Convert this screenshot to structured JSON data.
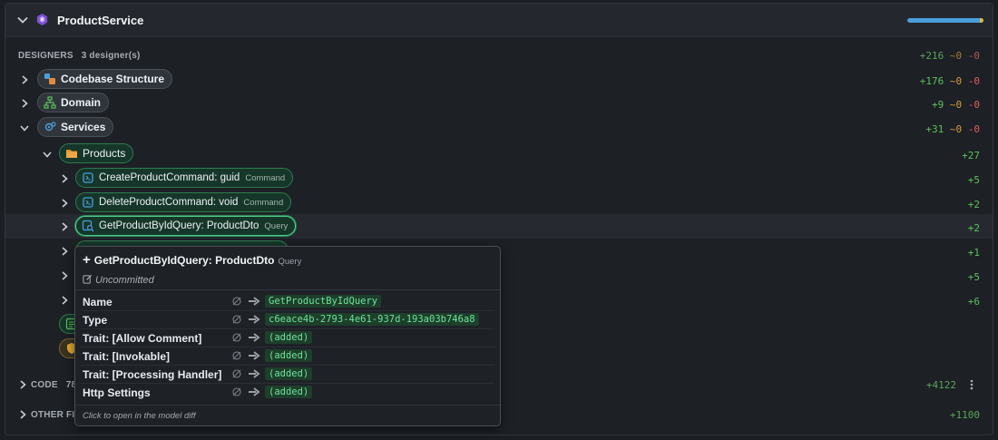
{
  "header": {
    "title": "ProductService",
    "progress": 0.98
  },
  "designers": {
    "label": "DESIGNERS",
    "count": "3 designer(s)",
    "stats": {
      "plus": "+216",
      "zero": "~0",
      "minus": "-0"
    }
  },
  "tree": {
    "codebase": {
      "label": "Codebase Structure",
      "stats": {
        "plus": "+176",
        "zero": "~0",
        "minus": "-0"
      }
    },
    "domain": {
      "label": "Domain",
      "stats": {
        "plus": "+9",
        "zero": "~0",
        "minus": "-0"
      }
    },
    "services": {
      "label": "Services",
      "stats": {
        "plus": "+31",
        "zero": "~0",
        "minus": "-0"
      }
    },
    "products": {
      "label": "Products",
      "stats": {
        "plus": "+27"
      }
    },
    "create": {
      "label": "CreateProductCommand: guid",
      "tag": "Command",
      "stats": {
        "plus": "+5"
      }
    },
    "delete": {
      "label": "DeleteProductCommand: void",
      "tag": "Command",
      "stats": {
        "plus": "+2"
      }
    },
    "getbyid": {
      "label": "GetProductByIdQuery: ProductDto",
      "tag": "Query",
      "stats": {
        "plus": "+2"
      }
    },
    "hidden1": {
      "stats": {
        "plus": "+1"
      }
    },
    "hidden2": {
      "stats": {
        "plus": "+5"
      }
    },
    "hidden3": {
      "stats": {
        "plus": "+6"
      }
    }
  },
  "code": {
    "label": "CODE",
    "count": "78",
    "stats": {
      "plus": "+4122"
    }
  },
  "other": {
    "label": "OTHER FI",
    "stats": {
      "plus": "+1100"
    }
  },
  "tooltip": {
    "plus": "+",
    "title": "GetProductByIdQuery: ProductDto",
    "tag": "Query",
    "status": "Uncommitted",
    "rows": [
      {
        "key": "Name",
        "value": "GetProductByIdQuery"
      },
      {
        "key": "Type",
        "value": "c6eace4b-2793-4e61-937d-193a03b746a8"
      },
      {
        "key": "Trait: [Allow Comment]",
        "value": "(added)"
      },
      {
        "key": "Trait: [Invokable]",
        "value": "(added)"
      },
      {
        "key": "Trait: [Processing Handler]",
        "value": "(added)"
      },
      {
        "key": "Http Settings",
        "value": "(added)"
      }
    ],
    "footer": "Click to open in the model diff"
  },
  "colors": {
    "added": "#5cc15c",
    "modified": "#d59a3c",
    "removed": "#e35d5d",
    "accent": "#4a9fdc"
  }
}
